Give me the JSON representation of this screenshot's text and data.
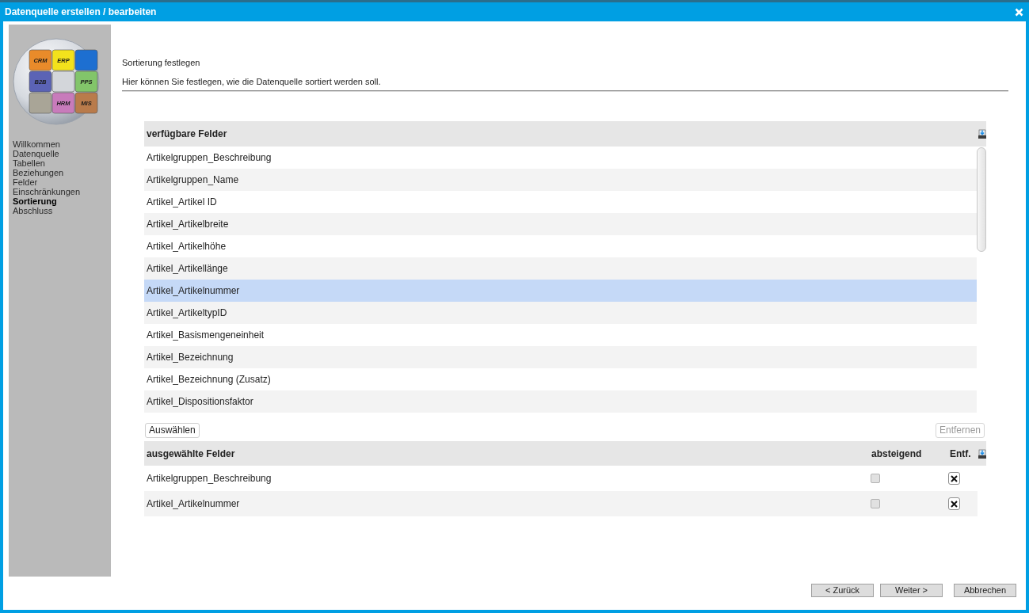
{
  "window": {
    "title": "Datenquelle erstellen / bearbeiten"
  },
  "logo": {
    "tiles": [
      {
        "label": "CRM",
        "color": "#e98b2a"
      },
      {
        "label": "ERP",
        "color": "#f3e21c"
      },
      {
        "color": "#1d6fd1"
      },
      {
        "label": "B2B",
        "color": "#5b63b5"
      },
      {
        "color": "#d3d6da"
      },
      {
        "label": "PPS",
        "color": "#82c56a"
      },
      {
        "color": "#a9a597"
      },
      {
        "label": "HRM",
        "color": "#c87bbb"
      },
      {
        "label": "MIS",
        "color": "#b97b4b"
      }
    ]
  },
  "sidebar": {
    "items": [
      {
        "label": "Willkommen",
        "selected": false
      },
      {
        "label": "Datenquelle",
        "selected": false
      },
      {
        "label": "Tabellen",
        "selected": false
      },
      {
        "label": "Beziehungen",
        "selected": false
      },
      {
        "label": "Felder",
        "selected": false
      },
      {
        "label": "Einschränkungen",
        "selected": false
      },
      {
        "label": "Sortierung",
        "selected": true
      },
      {
        "label": "Abschluss",
        "selected": false
      }
    ]
  },
  "page": {
    "heading": "Sortierung festlegen",
    "description": "Hier können Sie festlegen, wie die Datenquelle sortiert werden soll."
  },
  "available_fields": {
    "title": "verfügbare Felder",
    "rows": [
      {
        "label": "Artikelgruppen_Beschreibung",
        "selected": false
      },
      {
        "label": "Artikelgruppen_Name",
        "selected": false
      },
      {
        "label": "Artikel_Artikel ID",
        "selected": false
      },
      {
        "label": "Artikel_Artikelbreite",
        "selected": false
      },
      {
        "label": "Artikel_Artikelhöhe",
        "selected": false
      },
      {
        "label": "Artikel_Artikellänge",
        "selected": false
      },
      {
        "label": "Artikel_Artikelnummer",
        "selected": true
      },
      {
        "label": "Artikel_ArtikeltypID",
        "selected": false
      },
      {
        "label": "Artikel_Basismengeneinheit",
        "selected": false
      },
      {
        "label": "Artikel_Bezeichnung",
        "selected": false
      },
      {
        "label": "Artikel_Bezeichnung (Zusatz)",
        "selected": false
      },
      {
        "label": "Artikel_Dispositionsfaktor",
        "selected": false
      }
    ]
  },
  "select_button": {
    "label": "Auswählen"
  },
  "remove_button": {
    "label": "Entfernen",
    "disabled": true
  },
  "selected_fields": {
    "columns": [
      "ausgewählte Felder",
      "absteigend",
      "Entf."
    ],
    "rows": [
      {
        "label": "Artikelgruppen_Beschreibung",
        "descending": false
      },
      {
        "label": "Artikel_Artikelnummer",
        "descending": false
      }
    ]
  },
  "footer_buttons": [
    {
      "label": "< Zurück"
    },
    {
      "label": "Weiter >"
    },
    {
      "label": "Abbrechen"
    }
  ]
}
